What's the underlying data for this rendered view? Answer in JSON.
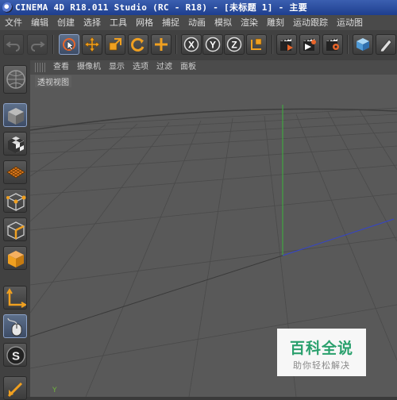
{
  "window": {
    "title": "CINEMA 4D R18.011 Studio (RC - R18) - [未标题 1] - 主要"
  },
  "menu": [
    "文件",
    "编辑",
    "创建",
    "选择",
    "工具",
    "网格",
    "捕捉",
    "动画",
    "模拟",
    "渲染",
    "雕刻",
    "运动跟踪",
    "运动图"
  ],
  "viewport_menu": [
    "查看",
    "摄像机",
    "显示",
    "选项",
    "过滤",
    "面板"
  ],
  "viewport": {
    "label": "透视视图",
    "axis_label": "Y"
  },
  "toolbar_icons": {
    "undo": "undo-icon",
    "redo": "redo-icon",
    "live_select": "live-select-icon",
    "move": "move-icon",
    "scale": "scale-icon",
    "rotate": "rotate-icon",
    "recent": "add-tool-icon",
    "x": "X",
    "y": "Y",
    "z": "Z",
    "coord": "world-coordinate-icon",
    "render_view": "render-view-icon",
    "render_picture_viewer": "render-to-picture-viewer-icon",
    "render_settings": "render-settings-icon",
    "cube": "cube-icon",
    "pen": "pen-icon"
  },
  "left_tools": [
    "model-mode-icon",
    "texture-mode-icon",
    "workplane-mode-icon",
    "points-mode-icon",
    "edges-mode-icon",
    "polygons-mode-icon",
    "enable-axis-icon",
    "tweak-mode-icon",
    "snap-icon"
  ],
  "watermark": {
    "title": "百科全说",
    "subtitle": "助你轻松解决"
  },
  "colors": {
    "viewport_bg": "#595959",
    "y_axis": "#3cb33c",
    "x_axis": "#3344cc",
    "selected": "#8ba1c7",
    "accent_orange": "#f0a020"
  }
}
